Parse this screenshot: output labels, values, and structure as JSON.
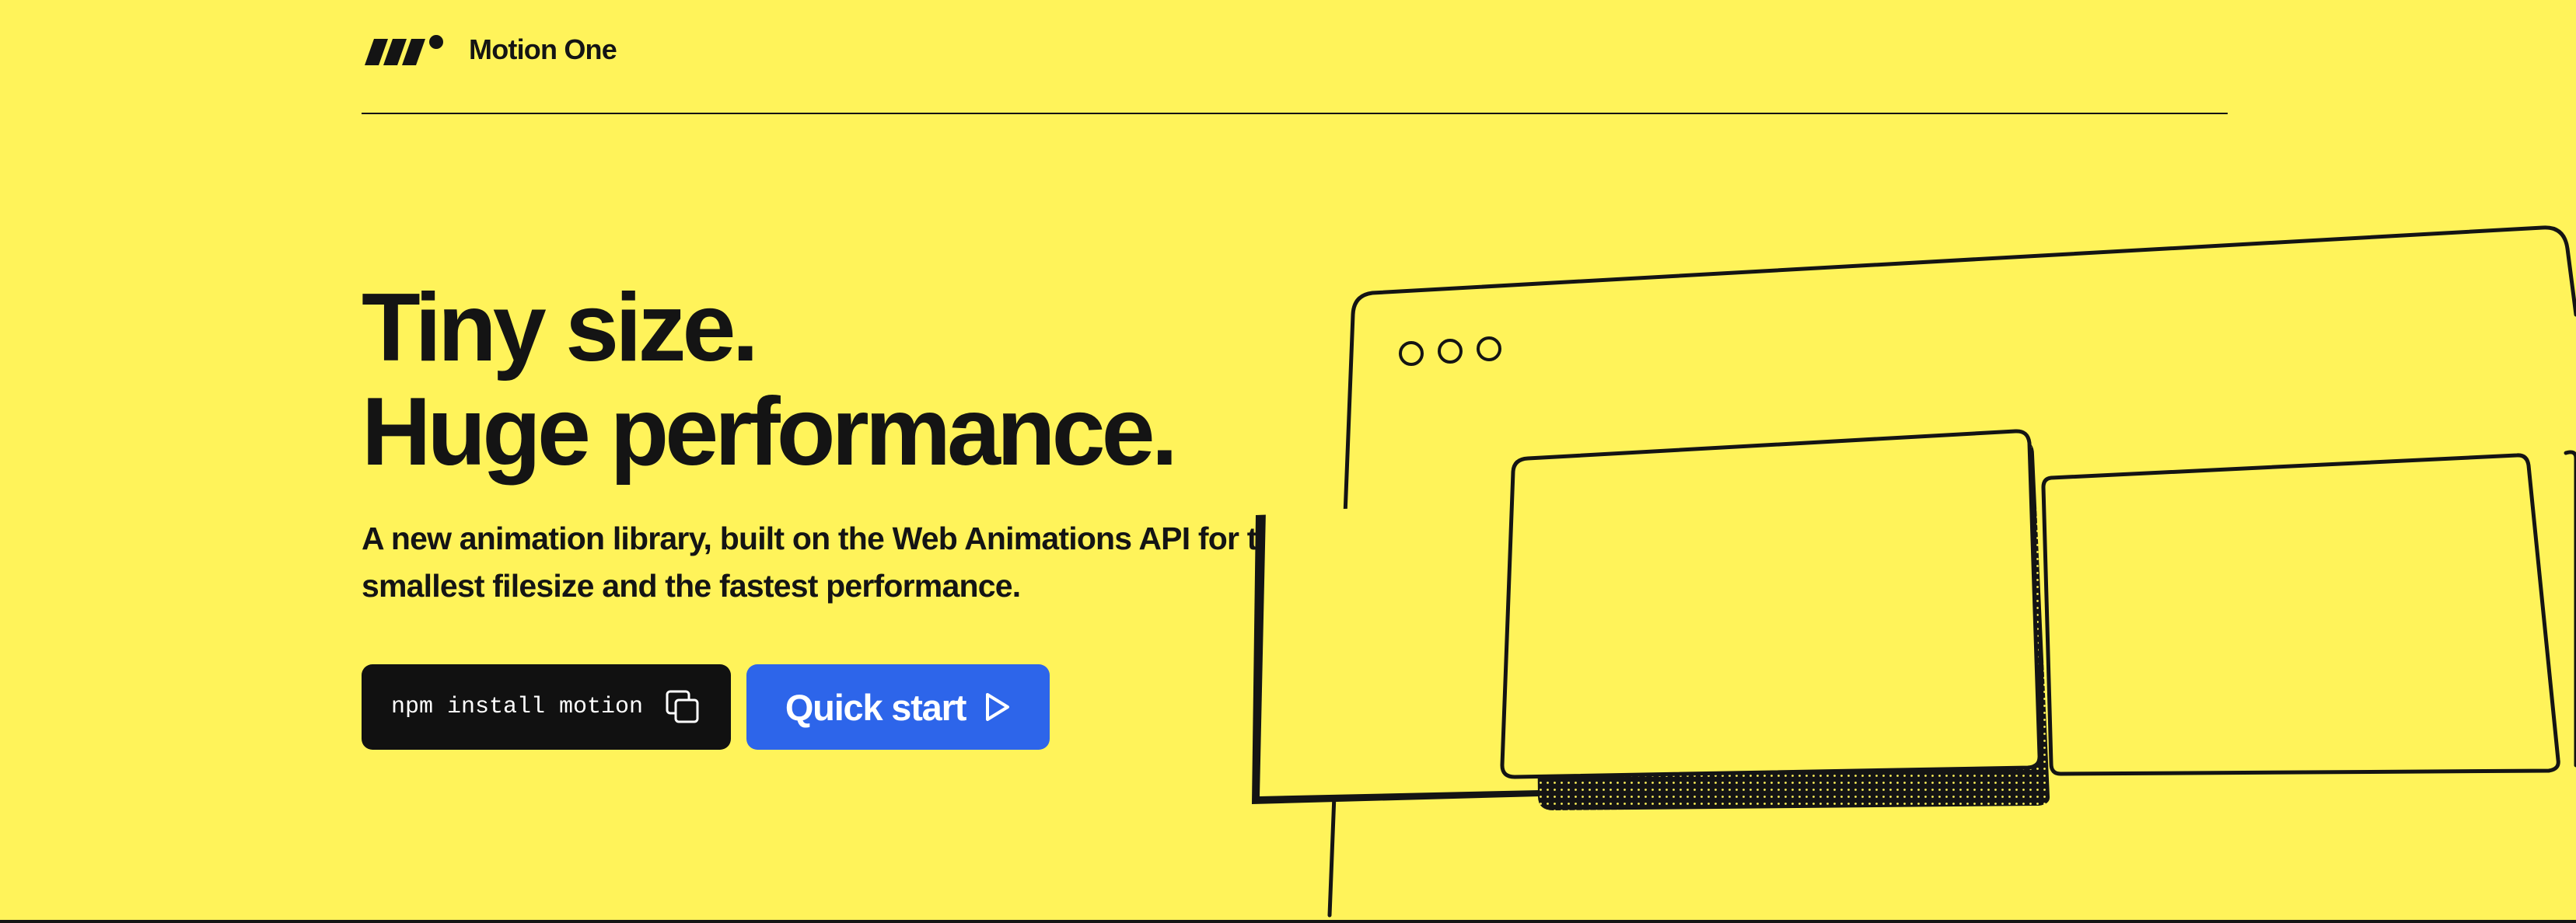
{
  "brand": {
    "name": "Motion One",
    "logo_icon": "motion-one-logo-icon"
  },
  "hero": {
    "title_line_1": "Tiny size.",
    "title_line_2": "Huge performance.",
    "subtitle": "A new animation library, built on the Web Animations API for the smallest filesize and the fastest performance."
  },
  "actions": {
    "install_command": "npm install motion",
    "copy_icon": "copy-icon",
    "quickstart_label": "Quick start",
    "quickstart_icon": "play-icon"
  },
  "colors": {
    "background": "#FFF35A",
    "ink": "#141414",
    "primary_button": "#2D65EA",
    "install_button": "#111111"
  }
}
